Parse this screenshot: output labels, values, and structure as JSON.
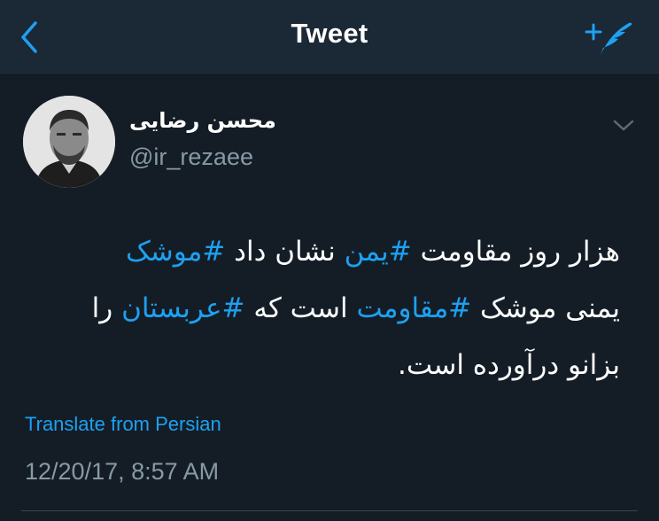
{
  "navbar": {
    "title": "Tweet",
    "back_icon": "chevron-left-icon",
    "compose_icon": "compose-tweet-icon",
    "accent_color": "#1da1f2"
  },
  "tweet": {
    "author_name": "محسن رضایی",
    "author_handle": "@ir_rezaee",
    "menu_icon": "chevron-down-icon",
    "text_lines": [
      [
        {
          "text": "هزار روز مقاومت ",
          "hashtag": false
        },
        {
          "text": "#یمن",
          "hashtag": true
        },
        {
          "text": " نشان داد ",
          "hashtag": false
        },
        {
          "text": "#موشک",
          "hashtag": true
        }
      ],
      [
        {
          "text": "یمنی موشک ",
          "hashtag": false
        },
        {
          "text": "#مقاومت",
          "hashtag": true
        },
        {
          "text": " است که ",
          "hashtag": false
        },
        {
          "text": "#عربستان",
          "hashtag": true
        },
        {
          "text": " را",
          "hashtag": false
        }
      ],
      [
        {
          "text": "بزانو درآورده است.",
          "hashtag": false
        }
      ]
    ],
    "translate_label": "Translate from Persian",
    "timestamp": "12/20/17, 8:57 AM"
  },
  "theme": {
    "background": "#141d26",
    "navbar_background": "#1b2836",
    "secondary_text": "#8899a6"
  }
}
